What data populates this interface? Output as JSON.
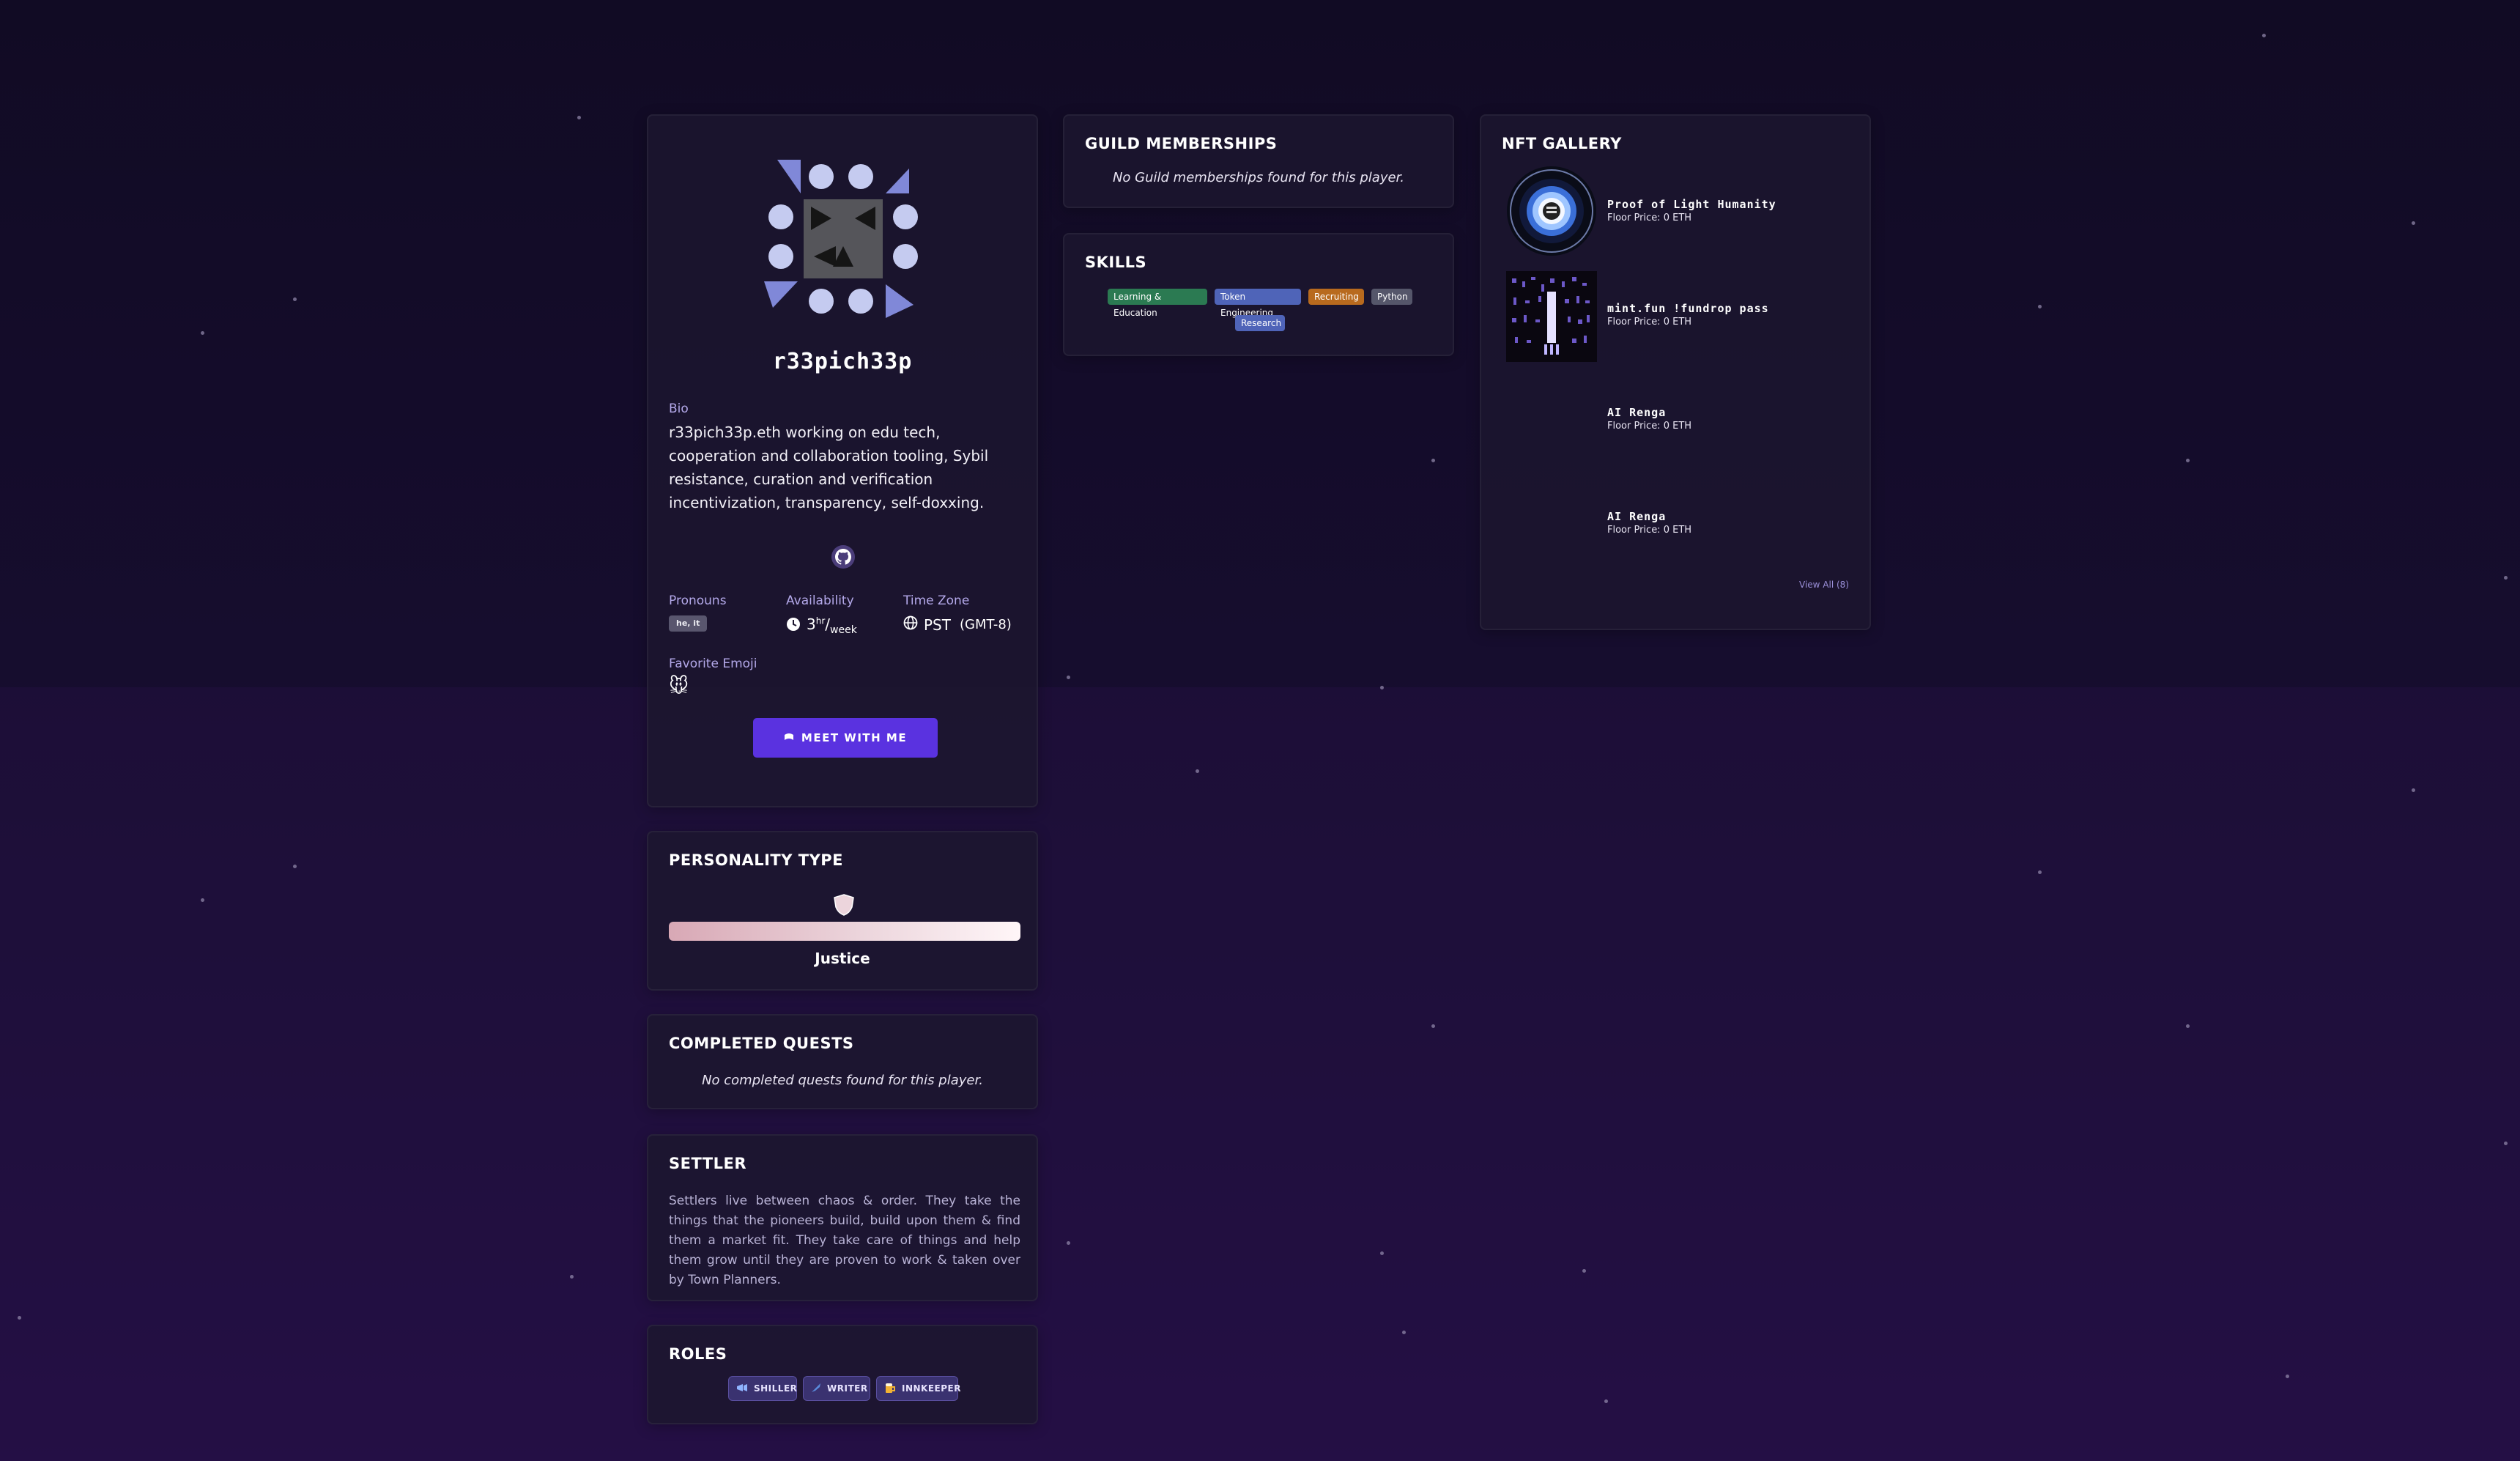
{
  "profile": {
    "username": "r33pich33p",
    "bio_label": "Bio",
    "bio": "r33pich33p.eth working on edu tech, cooperation and collaboration tooling, Sybil resistance, curation and verification incentivization, transparency, self-doxxing.",
    "social_icon": "github-icon",
    "pronouns_label": "Pronouns",
    "pronouns": "he, it",
    "availability_label": "Availability",
    "availability_value": "3",
    "availability_unit_top": "hr",
    "availability_unit_bottom": "week",
    "timezone_label": "Time Zone",
    "timezone": "PST",
    "timezone_offset": "(GMT-8)",
    "emoji_label": "Favorite Emoji",
    "emoji": "🐭",
    "meet_button": "MEET WITH ME"
  },
  "personality": {
    "title": "PERSONALITY TYPE",
    "name": "Justice",
    "colors": [
      "#d8a8b5",
      "#ecd5dc",
      "#fff6f8"
    ]
  },
  "completed_quests": {
    "title": "COMPLETED QUESTS",
    "empty": "No completed quests found for this player."
  },
  "settler": {
    "title": "SETTLER",
    "description": "Settlers live between chaos & order. They take the things that the pioneers build, build upon them & find them a market fit. They take care of things and help them grow until they are proven to work & taken over by Town Planners."
  },
  "roles": {
    "title": "ROLES",
    "items": [
      {
        "label": "SHILLER",
        "icon": "megaphone-icon"
      },
      {
        "label": "WRITER",
        "icon": "quill-icon"
      },
      {
        "label": "INNKEEPER",
        "icon": "beer-icon"
      }
    ]
  },
  "guilds": {
    "title": "GUILD MEMBERSHIPS",
    "empty": "No Guild memberships found for this player."
  },
  "skills": {
    "title": "SKILLS",
    "items": [
      {
        "label": "Learning & Education",
        "color": "#2b7a52"
      },
      {
        "label": "Token Engineering",
        "color": "#4f64b8"
      },
      {
        "label": "Recruiting",
        "color": "#b86a1e"
      },
      {
        "label": "Python",
        "color": "#55566a"
      },
      {
        "label": "Research",
        "color": "#4f64b8"
      }
    ]
  },
  "nft_gallery": {
    "title": "NFT GALLERY",
    "items": [
      {
        "title": "Proof of Light Humanity",
        "floor": "Floor Price: 0 ETH"
      },
      {
        "title": "mint.fun !fundrop pass",
        "floor": "Floor Price: 0 ETH"
      },
      {
        "title": "AI Renga",
        "floor": "Floor Price: 0 ETH"
      },
      {
        "title": "AI Renga",
        "floor": "Floor Price: 0 ETH"
      }
    ],
    "view_all": "View All (8)"
  }
}
